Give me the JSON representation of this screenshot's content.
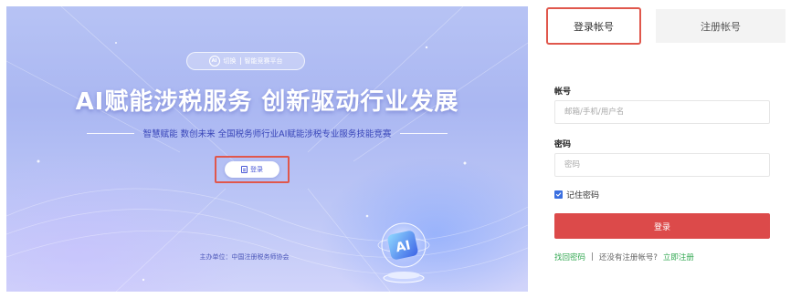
{
  "banner": {
    "pill_logo": "AI",
    "pill_left": "切换",
    "pill_right": "智能竞赛平台",
    "title": "AI赋能涉税服务 创新驱动行业发展",
    "subtitle": "智慧赋能 数创未来 全国税务师行业AI赋能涉税专业服务技能竞赛",
    "login_button": "登录",
    "organizer": "主办单位：中国注册税务师协会",
    "badge_text": "AI"
  },
  "tabs": {
    "login": "登录帐号",
    "register": "注册帐号"
  },
  "form": {
    "account_label": "帐号",
    "account_placeholder": "邮箱/手机/用户名",
    "password_label": "密码",
    "password_placeholder": "密码",
    "remember_label": "记住密码",
    "remember_checked": true,
    "submit_label": "登录"
  },
  "links": {
    "forgot": "找回密码",
    "separator": "|",
    "no_account": "还没有注册帐号?",
    "register_now": "立即注册"
  },
  "colors": {
    "accent_red": "#dc4a4a",
    "highlight_frame": "#e0574c",
    "link_green": "#33a852",
    "banner_blue": "#aab7f2",
    "checkbox_blue": "#3a6fe0"
  }
}
